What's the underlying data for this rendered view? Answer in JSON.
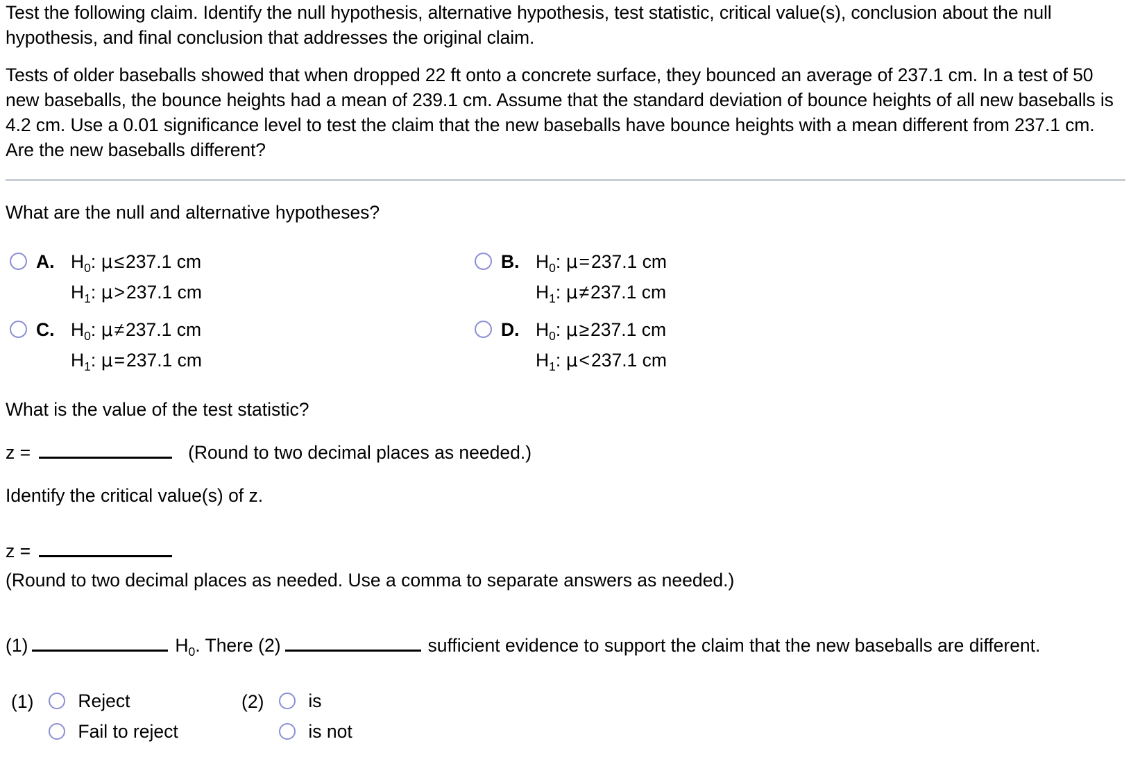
{
  "problem": {
    "instruction": "Test the following claim. Identify the null hypothesis, alternative hypothesis, test statistic, critical value(s), conclusion about the null hypothesis, and final conclusion that addresses the original claim.",
    "scenario": "Tests of older baseballs showed that when dropped 22 ft onto a concrete surface, they bounced an average of 237.1 cm. In a test of 50 new baseballs, the bounce heights had a mean of 239.1 cm. Assume that the standard deviation of bounce heights of all new baseballs is 4.2 cm. Use a 0.01 significance level to test the claim that the new baseballs have bounce heights with a mean different from 237.1 cm. Are the new baseballs different?"
  },
  "question_hypotheses": {
    "prompt": "What are the null and alternative hypotheses?",
    "options": [
      {
        "letter": "A.",
        "null_label": "H",
        "null_sub": "0",
        "null_sep": ":",
        "null_var": "μ",
        "null_op": "≤",
        "null_value": "237.1 cm",
        "alt_label": "H",
        "alt_sub": "1",
        "alt_sep": ":",
        "alt_var": "μ",
        "alt_op": ">",
        "alt_value": "237.1 cm"
      },
      {
        "letter": "B.",
        "null_label": "H",
        "null_sub": "0",
        "null_sep": ":",
        "null_var": "μ",
        "null_op": "=",
        "null_value": "237.1 cm",
        "alt_label": "H",
        "alt_sub": "1",
        "alt_sep": ":",
        "alt_var": "μ",
        "alt_op": "≠",
        "alt_value": "237.1 cm"
      },
      {
        "letter": "C.",
        "null_label": "H",
        "null_sub": "0",
        "null_sep": ":",
        "null_var": "μ",
        "null_op": "≠",
        "null_value": "237.1 cm",
        "alt_label": "H",
        "alt_sub": "1",
        "alt_sep": ":",
        "alt_var": "μ",
        "alt_op": "=",
        "alt_value": "237.1 cm"
      },
      {
        "letter": "D.",
        "null_label": "H",
        "null_sub": "0",
        "null_sep": ":",
        "null_var": "μ",
        "null_op": "≥",
        "null_value": "237.1 cm",
        "alt_label": "H",
        "alt_sub": "1",
        "alt_sep": ":",
        "alt_var": "μ",
        "alt_op": "<",
        "alt_value": "237.1 cm"
      }
    ]
  },
  "question_test_statistic": {
    "prompt": "What is the value of the test statistic?",
    "z_label": "z =",
    "z_value": "",
    "round_note": "(Round to two decimal places as needed.)"
  },
  "question_critical_value": {
    "prompt": "Identify the critical value(s) of z.",
    "z_label": "z =",
    "z_value": "",
    "round_note": "(Round to two decimal places as needed. Use a comma to separate answers as needed.)"
  },
  "conclusion": {
    "tag1": "(1)",
    "mid_h": "H",
    "mid_h_sub": "0",
    "mid_text": ". There",
    "tag2": "(2)",
    "tail": "sufficient evidence to support the claim that the new baseballs are different."
  },
  "bottom_groups": [
    {
      "tag": "(1)",
      "options": [
        "Reject",
        "Fail to reject"
      ]
    },
    {
      "tag": "(2)",
      "options": [
        "is",
        "is not"
      ]
    }
  ],
  "colors": {
    "radio_border": "#8c8fd4",
    "divider": "#c8cdd6",
    "text": "#000000",
    "background": "#ffffff"
  }
}
